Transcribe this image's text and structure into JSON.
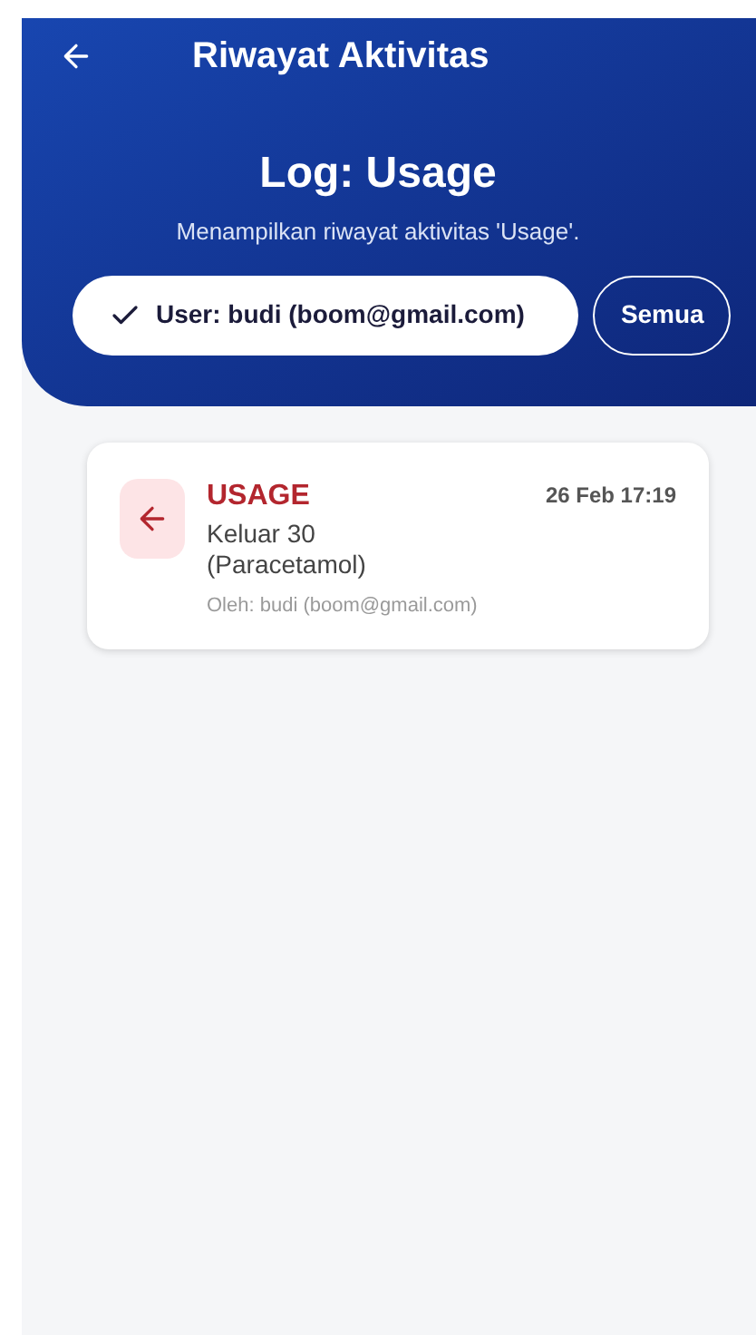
{
  "header": {
    "title": "Riwayat Aktivitas",
    "heading": "Log: Usage",
    "subtitle": "Menampilkan riwayat aktivitas 'Usage'."
  },
  "filters": [
    {
      "label": "User: budi (boom@gmail.com)",
      "selected": true
    },
    {
      "label": "Semua",
      "selected": false
    }
  ],
  "logs": [
    {
      "kind": "out",
      "type": "USAGE",
      "time": "26 Feb 17:19",
      "lines": [
        "Keluar 30",
        "(Paracetamol)"
      ],
      "by": "Oleh: budi (boom@gmail.com)"
    }
  ]
}
